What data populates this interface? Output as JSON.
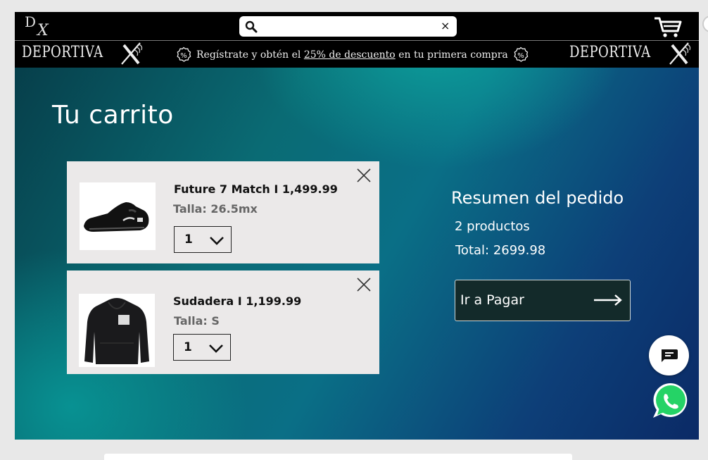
{
  "header": {
    "search": {
      "value": "",
      "placeholder": "",
      "clear_symbol": "×"
    },
    "logo_small": {
      "letter_d": "D",
      "letter_x": "X"
    }
  },
  "promo_bar": {
    "brand_left": "DEPORTIVA",
    "brand_right": "DEPORTIVA",
    "text_before": "Regístrate y obtén el ",
    "link_text": "25% de descuento",
    "text_after": " en tu primera compra"
  },
  "cart": {
    "title": "Tu carrito",
    "items": [
      {
        "name": "Future 7 Match I 1,499.99",
        "size": "Talla: 26.5mx",
        "quantity": "1",
        "image_icon": "black-soccer-shoe-image"
      },
      {
        "name": "Sudadera I 1,199.99",
        "size": "Talla: S",
        "quantity": "1",
        "image_icon": "black-hoodie-image"
      }
    ]
  },
  "summary": {
    "title": "Resumen del pedido",
    "count": "2 productos",
    "total": "Total: 2699.98",
    "pay_label": "Ir a Pagar"
  },
  "colors": {
    "bar_bg": "#000000",
    "card_bg": "#ebe9e9",
    "pay_button_bg": "#132a2a",
    "whatsapp_green": "#25d366",
    "teal_accent": "#0a8f8f"
  }
}
